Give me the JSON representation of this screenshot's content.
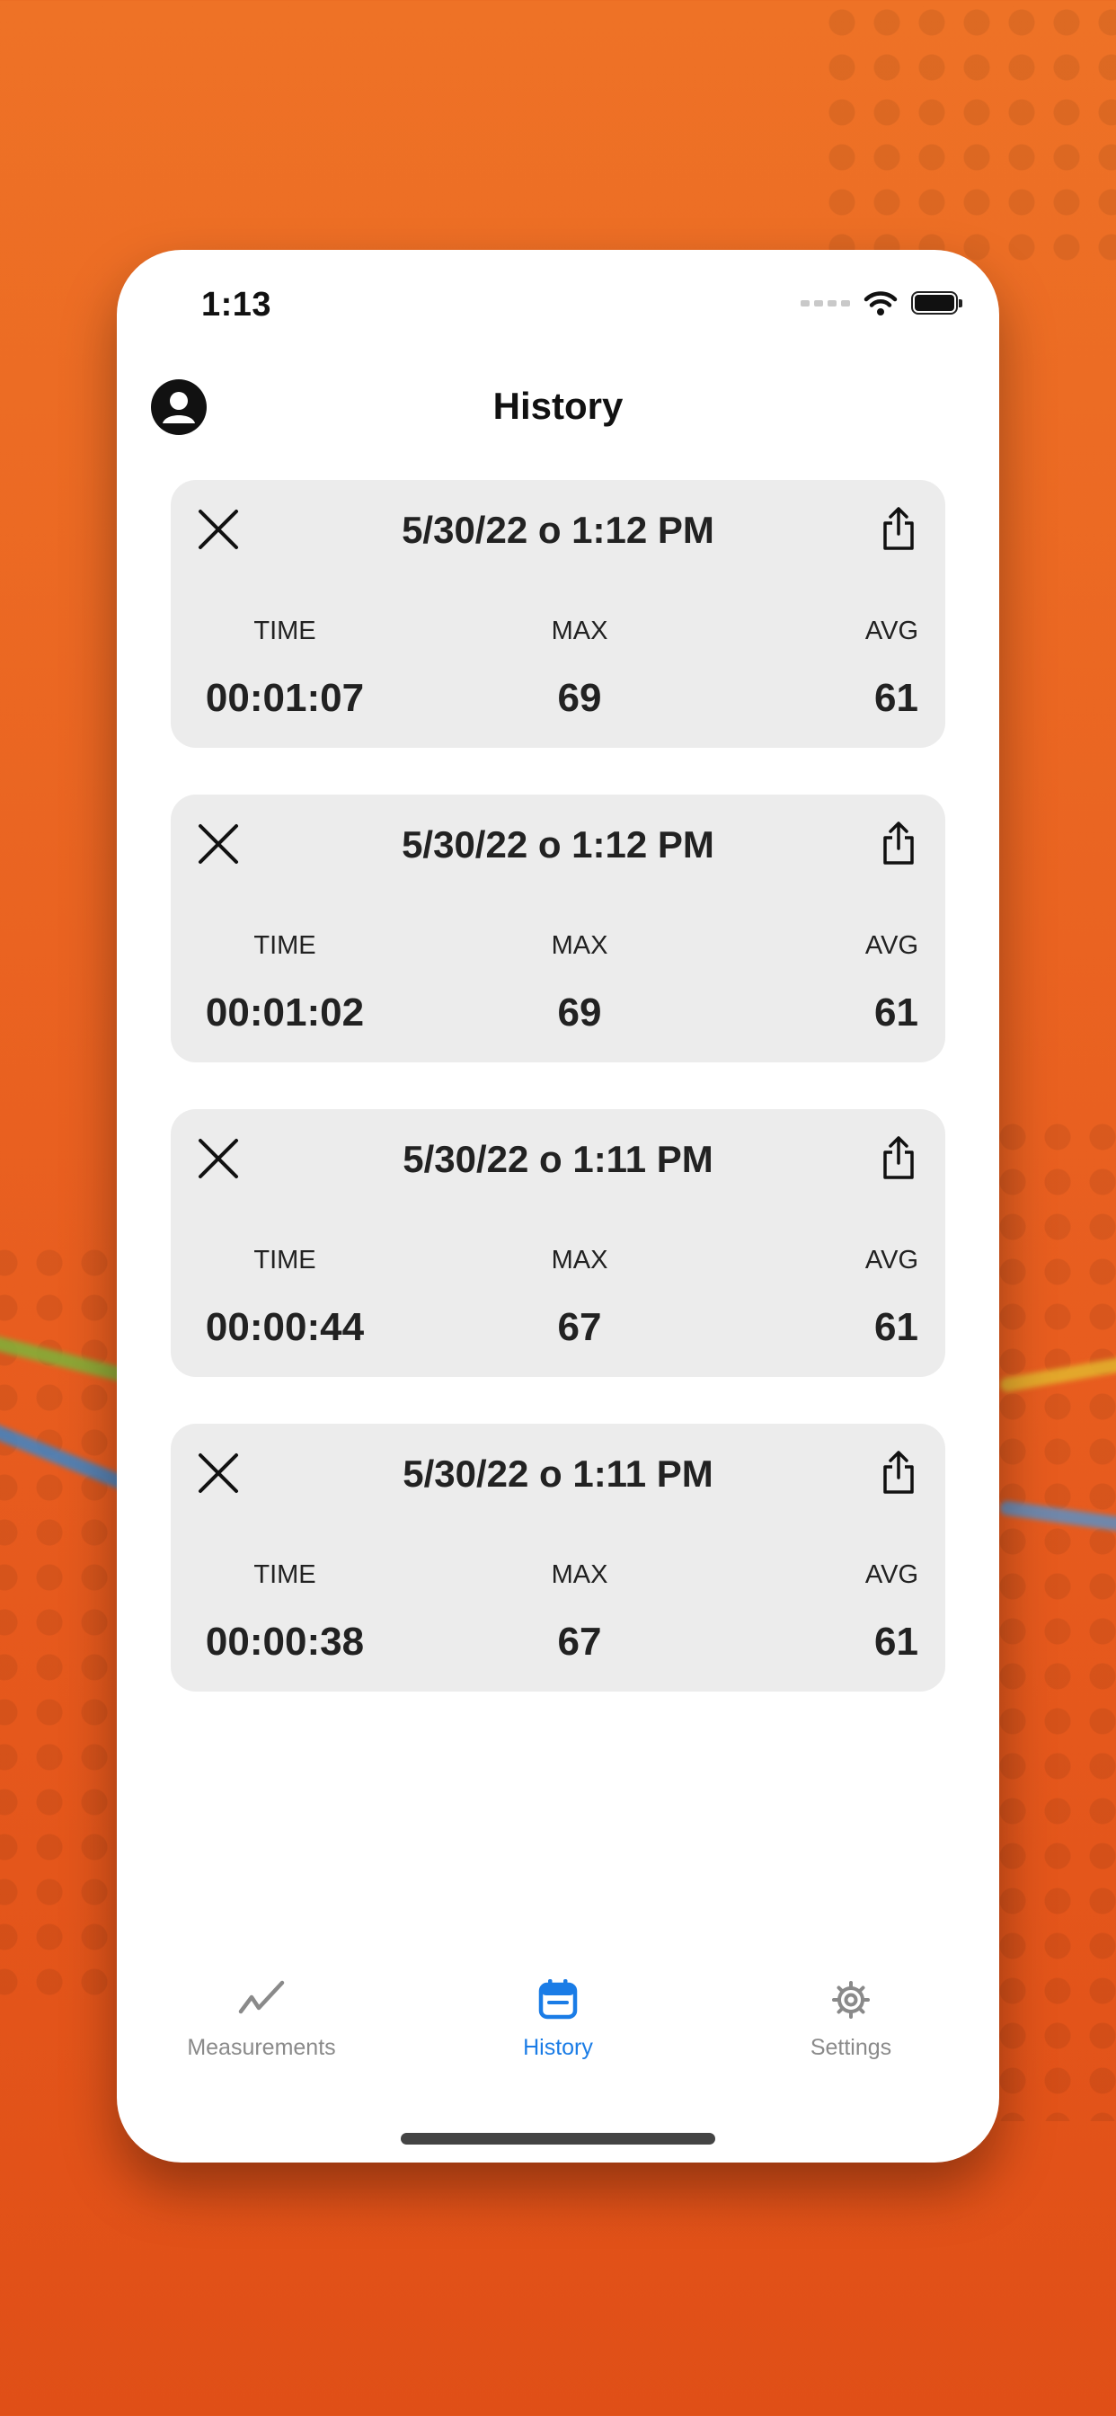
{
  "status_bar": {
    "time": "1:13"
  },
  "header": {
    "title": "History"
  },
  "history": [
    {
      "date": "5/30/22 o 1:12 PM",
      "time_label": "TIME",
      "max_label": "MAX",
      "avg_label": "AVG",
      "time": "00:01:07",
      "max": "69",
      "avg": "61"
    },
    {
      "date": "5/30/22 o 1:12 PM",
      "time_label": "TIME",
      "max_label": "MAX",
      "avg_label": "AVG",
      "time": "00:01:02",
      "max": "69",
      "avg": "61"
    },
    {
      "date": "5/30/22 o 1:11 PM",
      "time_label": "TIME",
      "max_label": "MAX",
      "avg_label": "AVG",
      "time": "00:00:44",
      "max": "67",
      "avg": "61"
    },
    {
      "date": "5/30/22 o 1:11 PM",
      "time_label": "TIME",
      "max_label": "MAX",
      "avg_label": "AVG",
      "time": "00:00:38",
      "max": "67",
      "avg": "61"
    }
  ],
  "tab_bar": {
    "tabs": [
      {
        "label": "Measurements",
        "icon": "chart-line-icon",
        "active": false
      },
      {
        "label": "History",
        "icon": "calendar-icon",
        "active": true
      },
      {
        "label": "Settings",
        "icon": "gear-icon",
        "active": false
      }
    ]
  },
  "colors": {
    "accent": "#1a7ce6",
    "background": "#e85d1f",
    "card": "#ececec",
    "inactive": "#8a8a8a"
  }
}
